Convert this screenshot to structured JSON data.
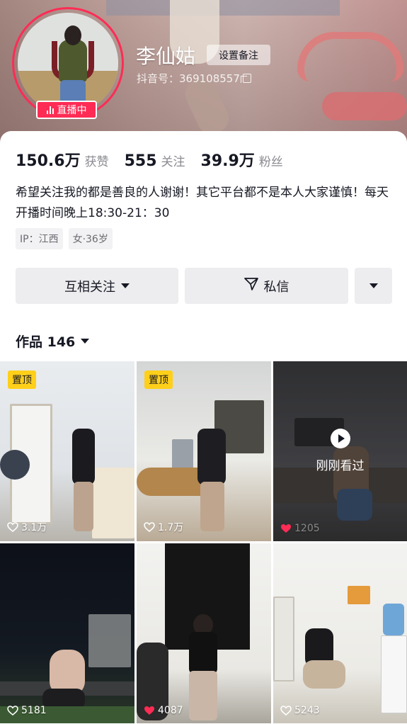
{
  "profile": {
    "nickname": "李仙姑",
    "remark_button": "设置备注",
    "douyin_id": "抖音号：369108557",
    "live_badge": "直播中",
    "accent_color": "#fe2c55"
  },
  "stats": [
    {
      "value": "150.6万",
      "label": "获赞"
    },
    {
      "value": "555",
      "label": "关注"
    },
    {
      "value": "39.9万",
      "label": "粉丝"
    }
  ],
  "bio": "希望关注我的都是善良的人谢谢！其它平台都不是本人大家谨慎！每天开播时间晚上18:30-21：30",
  "tags": [
    "IP：江西",
    "女·36岁"
  ],
  "actions": {
    "follow": "互相关注",
    "message": "私信"
  },
  "works": {
    "title": "作品 146"
  },
  "videos": [
    {
      "pinned": "置顶",
      "likes": "3.1万",
      "liked": false
    },
    {
      "pinned": "置顶",
      "likes": "1.7万",
      "liked": false
    },
    {
      "overlay": "刚刚看过",
      "likes": "1205",
      "liked": true
    },
    {
      "likes": "5181",
      "liked": false
    },
    {
      "likes": "4087",
      "liked": true
    },
    {
      "likes": "5243",
      "liked": false
    }
  ]
}
